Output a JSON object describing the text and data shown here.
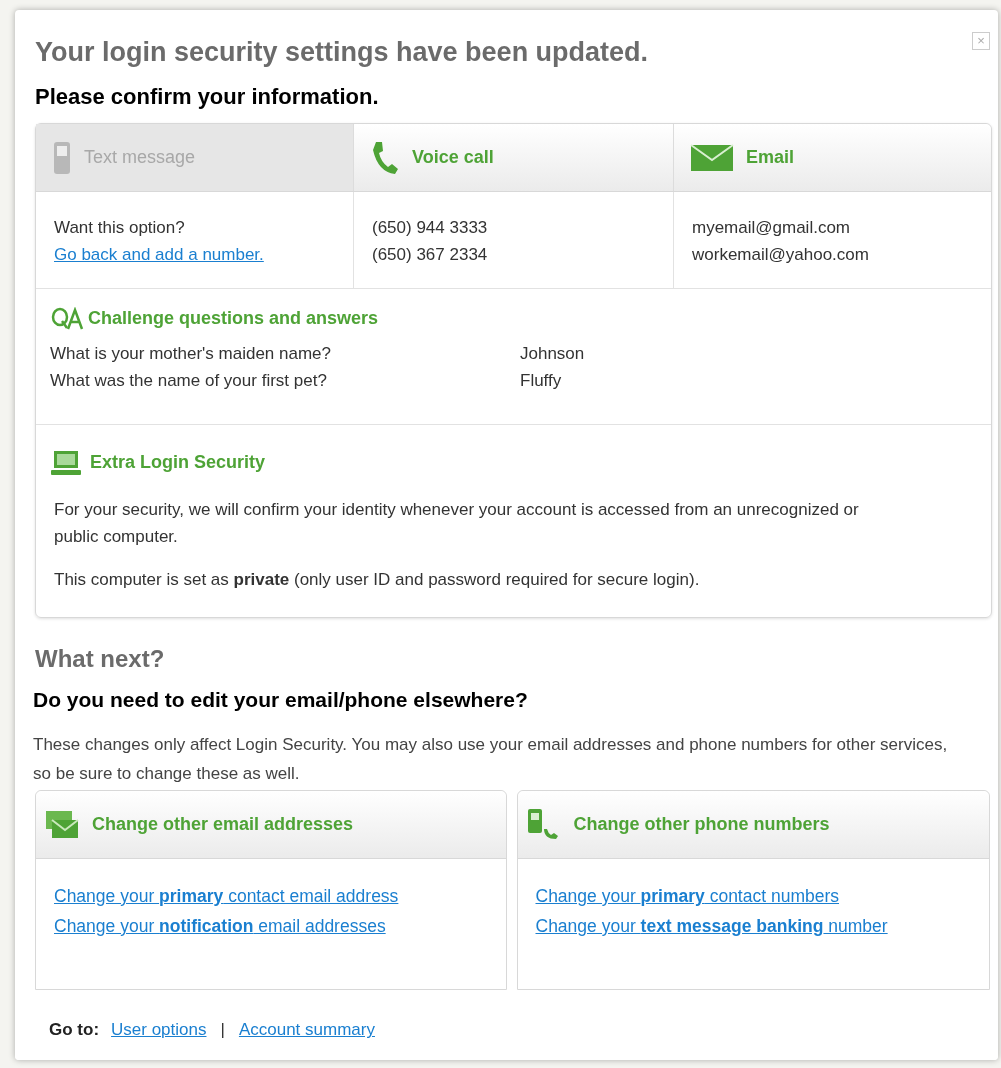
{
  "dialog": {
    "title": "Your login security settings have been updated.",
    "subtitle": "Please confirm your information.",
    "close": "×"
  },
  "methods": [
    {
      "kind": "text",
      "label": "Text message",
      "enabled": false,
      "lines": [
        "Want this option?"
      ],
      "link": "Go back and add a number."
    },
    {
      "kind": "voice",
      "label": "Voice call",
      "enabled": true,
      "lines": [
        "(650) 944 3333",
        "(650) 367 2334"
      ]
    },
    {
      "kind": "email",
      "label": "Email",
      "enabled": true,
      "lines": [
        "myemail@gmail.com",
        "workemail@yahoo.com"
      ]
    }
  ],
  "challenge": {
    "title": "Challenge questions and answers",
    "rows": [
      {
        "question": "What is your mother's maiden name?",
        "answer": "Johnson"
      },
      {
        "question": "What was the name of your first pet?",
        "answer": "Fluffy"
      }
    ]
  },
  "extra_security": {
    "title": "Extra Login Security",
    "paragraphs": [
      "For your security, we will confirm your identity whenever your account is accessed from an unrecognized or public computer.",
      "This computer is set as **private** (only user ID and password required for secure login)."
    ]
  },
  "what_next": {
    "title": "What next?",
    "question": "Do you need to edit your email/phone elsewhere?",
    "text": "These changes only affect Login Security. You may also use your email addresses and phone numbers for other services, so be sure to change these as well."
  },
  "cards": [
    {
      "kind": "email",
      "title": "Change other email addresses",
      "links": [
        "Change your **primary** contact email address",
        "Change your **notification** email addresses"
      ]
    },
    {
      "kind": "phone",
      "title": "Change other phone numbers",
      "links": [
        "Change your **primary** contact  numbers",
        "Change your **text message banking** number"
      ]
    }
  ],
  "goto": {
    "label": "Go to:",
    "links": [
      "User options",
      "Account summary"
    ],
    "separator": "|"
  }
}
